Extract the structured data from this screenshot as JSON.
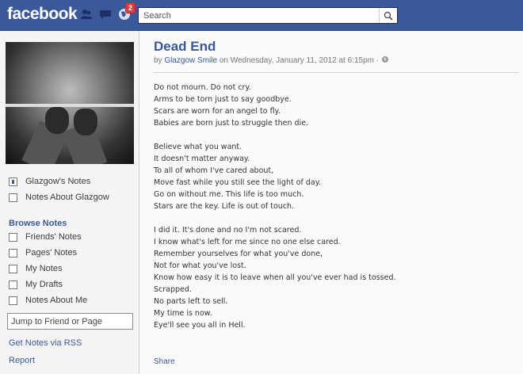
{
  "header": {
    "logo": "facebook",
    "notification_count": "2",
    "search_placeholder": "Search"
  },
  "sidebar": {
    "notes_items": [
      {
        "label": "Glazgow's Notes"
      },
      {
        "label": "Notes About Glazgow"
      }
    ],
    "browse_heading": "Browse Notes",
    "browse_items": [
      {
        "label": "Friends' Notes"
      },
      {
        "label": "Pages' Notes"
      },
      {
        "label": "My Notes"
      },
      {
        "label": "My Drafts"
      },
      {
        "label": "Notes About Me"
      }
    ],
    "jump_placeholder": "Jump to Friend or Page",
    "rss_link": "Get Notes via RSS",
    "report_link": "Report"
  },
  "note": {
    "title": "Dead End",
    "by_prefix": "by",
    "author": "Glazgow Smile",
    "date_text": "on Wednesday, January 11, 2012 at 6:15pm ·",
    "stanzas": [
      [
        "Do not mourn. Do not cry.",
        "Arms to be torn just to say goodbye.",
        "Scars are worn for an angel to fly.",
        "Babies are born just to struggle then die."
      ],
      [
        "Believe what you want.",
        "It doesn't matter anyway.",
        "To all of whom I've cared about,",
        "Move fast while you still see the light of day.",
        "Go on without me. This life is too much.",
        "Stars are the key. Life is out of touch."
      ],
      [
        "I did it. It's done and no I'm not scared.",
        "I know what's left for me since no one else cared.",
        "Remember yourselves for what you've done,",
        "Not for what you've lost.",
        "Know how easy it is to leave when all you've ever had is tossed.",
        "Scrapped.",
        "No parts left to sell.",
        "My time is now.",
        "Eye'll see you all in Hell."
      ]
    ],
    "share_label": "Share"
  },
  "colors": {
    "brand": "#3b5998",
    "badge": "#e0393e"
  }
}
